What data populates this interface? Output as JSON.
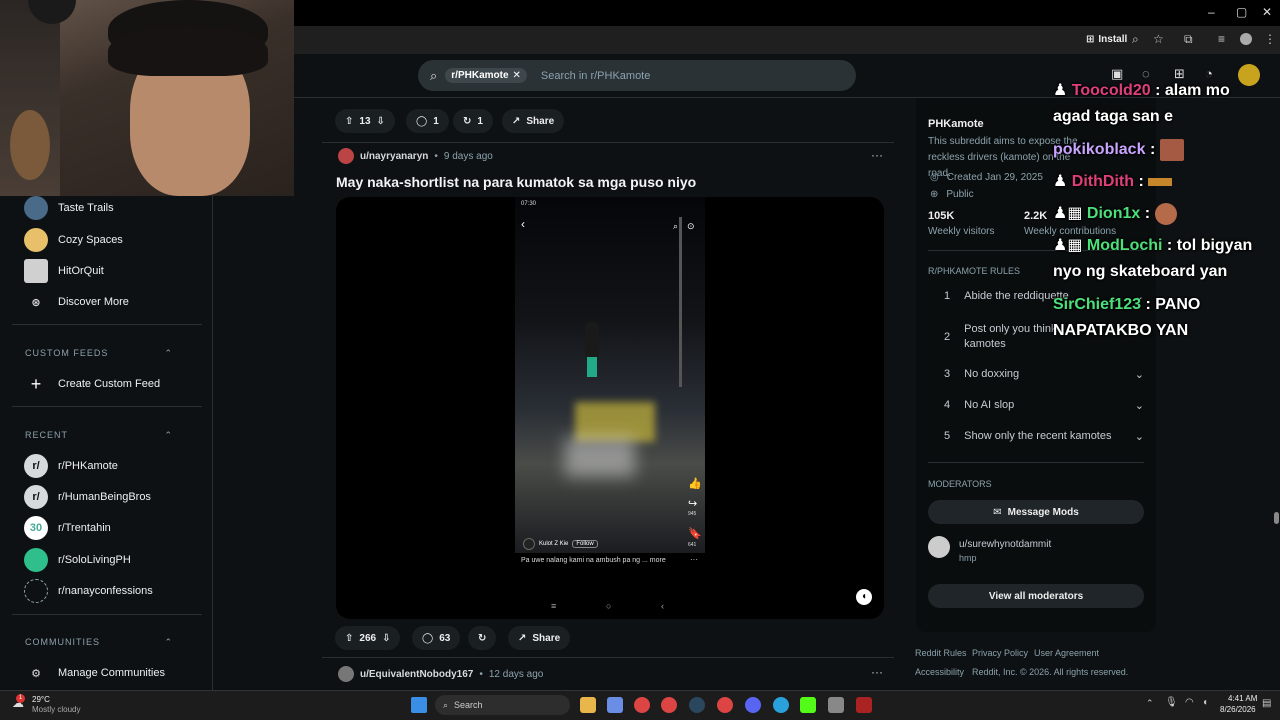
{
  "browser": {
    "install_label": "Install",
    "window_controls": [
      "–",
      "▢",
      "✕"
    ]
  },
  "search": {
    "community_chip": "r/PHKamote",
    "placeholder": "Search in r/PHKamote"
  },
  "sidebar": {
    "items_top": [
      {
        "label": "Taste Trails",
        "color": "#4a6a8a"
      },
      {
        "label": "Cozy Spaces",
        "color": "#e8c06a"
      },
      {
        "label": "HitOrQuit",
        "color": "#d0d0d0"
      },
      {
        "label": "Discover More",
        "color": "#0e1113"
      }
    ],
    "custom_feeds_header": "CUSTOM FEEDS",
    "create_custom_feed": "Create Custom Feed",
    "recent_header": "RECENT",
    "recent": [
      {
        "label": "r/PHKamote",
        "color": "#d7dadc"
      },
      {
        "label": "r/HumanBeingBros",
        "color": "#d7dadc"
      },
      {
        "label": "r/Trentahin",
        "color": "#ffffff"
      },
      {
        "label": "r/SoloLivingPH",
        "color": "#2fbf8a"
      },
      {
        "label": "r/nanayconfessions",
        "color": "#0e1113"
      }
    ],
    "communities_header": "COMMUNITIES",
    "manage_communities": "Manage Communities"
  },
  "prev_post_actions": {
    "votes": "13",
    "comments": "1",
    "crossposts": "1",
    "share": "Share"
  },
  "post": {
    "author": "u/nayryanaryn",
    "age": "9 days ago",
    "title": "May naka-shortlist na para kumatok sa mga puso niyo",
    "video": {
      "status_time": "07:30",
      "channel": "Kulot Z Kie",
      "follow": "Follow",
      "caption": "Pa uwe nalang kami na ambush pa ng ... more",
      "likes": "",
      "shares": "945",
      "saves": "641"
    },
    "votes": "266",
    "comments": "63",
    "share": "Share"
  },
  "next_post": {
    "author": "u/EquivalentNobody167",
    "age": "12 days ago"
  },
  "community": {
    "name": "PHKamote",
    "description": "This subreddit aims to expose the reckless drivers (kamote) on the road.",
    "created": "Created Jan 29, 2025",
    "visibility": "Public",
    "visitors": "105K",
    "visitors_label": "Weekly visitors",
    "contributions": "2.2K",
    "contributions_label": "Weekly contributions",
    "rules_header": "R/PHKAMOTE RULES",
    "rules": [
      {
        "num": "1",
        "text": "Abide the reddiquette"
      },
      {
        "num": "2",
        "text": "Post only you think kamotes"
      },
      {
        "num": "3",
        "text": "No doxxing"
      },
      {
        "num": "4",
        "text": "No AI slop"
      },
      {
        "num": "5",
        "text": "Show only the recent kamotes"
      }
    ],
    "moderators_header": "MODERATORS",
    "message_mods": "Message Mods",
    "moderator": {
      "name": "u/surewhynotdammit",
      "flair": "hmp"
    },
    "view_all_mods": "View all moderators"
  },
  "footer_links": {
    "rules": "Reddit Rules",
    "privacy": "Privacy Policy",
    "agreement": "User Agreement",
    "accessibility": "Accessibility",
    "copyright": "Reddit, Inc. © 2026. All rights reserved."
  },
  "chat": [
    {
      "user": "Toocold20",
      "msg": ": alam mo",
      "cont": "agad taga san e"
    },
    {
      "user": "pokikoblack",
      "msg": ":"
    },
    {
      "user": "DithDith",
      "msg": ":"
    },
    {
      "user": "Dion1x",
      "msg": ":"
    },
    {
      "user": "ModLochi",
      "msg": ": tol bigyan",
      "cont": "nyo ng skateboard yan"
    },
    {
      "user": "SirChief123",
      "msg": ": PANO",
      "cont": "NAPATAKBO YAN"
    }
  ],
  "taskbar": {
    "weather_temp": "29°C",
    "weather_desc": "Mostly cloudy",
    "search": "Search",
    "time": "4:41 AM",
    "date": "8/26/2026",
    "notif_count": "1"
  }
}
